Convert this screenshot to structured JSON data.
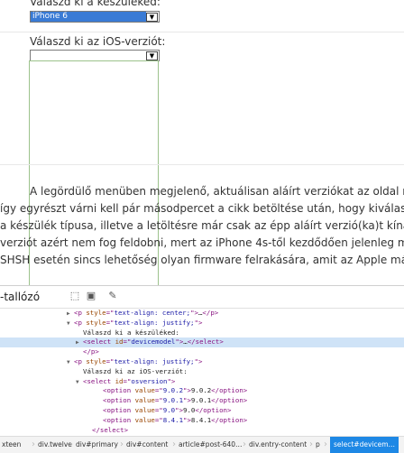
{
  "page": {
    "device_label": "Válaszd ki a készüléked:",
    "device_selected": "iPhone 6",
    "ios_label": "Válaszd ki az iOS-verziót:",
    "paragraph_lines": [
      "A legördülő menüben megjelenő, aktuálisan aláírt verziókat az oldal röptében ke",
      "így egyrészt várni kell pár másodpercet a cikk betöltése után, hogy kiválasztható",
      "a készülék típusa, illetve a letöltésre már csak az épp aláírt verzió(ka)t kínálja fel.",
      "verziót azért nem fog feldobni, mert az iPhone 4s-től kezdődően jelenleg még",
      "SHSH esetén sincs lehetőség olyan firmware felrakására, amit az Apple már nem"
    ]
  },
  "devtools": {
    "title": "-tallózó",
    "dom_rows": [
      {
        "indent": 74,
        "tri": "▶",
        "parts": [
          [
            "tag",
            "<p "
          ],
          [
            "attr",
            "style"
          ],
          [
            "tag",
            "=\""
          ],
          [
            "val",
            "text-align: center;"
          ],
          [
            "tag",
            "\">"
          ],
          [
            "txt",
            "…"
          ],
          [
            "tag",
            "</p>"
          ]
        ]
      },
      {
        "indent": 74,
        "tri": "▼",
        "parts": [
          [
            "tag",
            "<p "
          ],
          [
            "attr",
            "style"
          ],
          [
            "tag",
            "=\""
          ],
          [
            "val",
            "text-align: justify;"
          ],
          [
            "tag",
            "\">"
          ]
        ]
      },
      {
        "indent": 84,
        "tri": "",
        "parts": [
          [
            "txt",
            "Válaszd ki a készüléked:"
          ]
        ]
      },
      {
        "indent": 84,
        "tri": "▶",
        "sel": true,
        "parts": [
          [
            "tag",
            "<select "
          ],
          [
            "attr",
            "id"
          ],
          [
            "tag",
            "=\""
          ],
          [
            "val",
            "devicemodel"
          ],
          [
            "tag",
            "\">"
          ],
          [
            "txt",
            "…"
          ],
          [
            "tag",
            "</select>"
          ]
        ]
      },
      {
        "indent": 84,
        "tri": "",
        "parts": [
          [
            "tag",
            "</p>"
          ]
        ]
      },
      {
        "indent": 74,
        "tri": "▼",
        "parts": [
          [
            "tag",
            "<p "
          ],
          [
            "attr",
            "style"
          ],
          [
            "tag",
            "=\""
          ],
          [
            "val",
            "text-align: justify;"
          ],
          [
            "tag",
            "\">"
          ]
        ]
      },
      {
        "indent": 84,
        "tri": "",
        "parts": [
          [
            "txt",
            "Válaszd ki az iOS-verziót:"
          ]
        ]
      },
      {
        "indent": 84,
        "tri": "▼",
        "parts": [
          [
            "tag",
            "<select "
          ],
          [
            "attr",
            "id"
          ],
          [
            "tag",
            "=\""
          ],
          [
            "val",
            "osversion"
          ],
          [
            "tag",
            "\">"
          ]
        ]
      },
      {
        "indent": 106,
        "tri": "",
        "parts": [
          [
            "tag",
            "<option "
          ],
          [
            "attr",
            "value"
          ],
          [
            "tag",
            "=\""
          ],
          [
            "val",
            "9.0.2"
          ],
          [
            "tag",
            "\">"
          ],
          [
            "txt",
            "9.0.2"
          ],
          [
            "tag",
            "</option>"
          ]
        ]
      },
      {
        "indent": 106,
        "tri": "",
        "parts": [
          [
            "tag",
            "<option "
          ],
          [
            "attr",
            "value"
          ],
          [
            "tag",
            "=\""
          ],
          [
            "val",
            "9.0.1"
          ],
          [
            "tag",
            "\">"
          ],
          [
            "txt",
            "9.0.1"
          ],
          [
            "tag",
            "</option>"
          ]
        ]
      },
      {
        "indent": 106,
        "tri": "",
        "parts": [
          [
            "tag",
            "<option "
          ],
          [
            "attr",
            "value"
          ],
          [
            "tag",
            "=\""
          ],
          [
            "val",
            "9.0"
          ],
          [
            "tag",
            "\">"
          ],
          [
            "txt",
            "9.0"
          ],
          [
            "tag",
            "</option>"
          ]
        ]
      },
      {
        "indent": 106,
        "tri": "",
        "parts": [
          [
            "tag",
            "<option "
          ],
          [
            "attr",
            "value"
          ],
          [
            "tag",
            "=\""
          ],
          [
            "val",
            "8.4.1"
          ],
          [
            "tag",
            "\">"
          ],
          [
            "txt",
            "8.4.1"
          ],
          [
            "tag",
            "</option>"
          ]
        ]
      },
      {
        "indent": 94,
        "tri": "",
        "parts": [
          [
            "tag",
            "</select>"
          ]
        ]
      }
    ],
    "breadcrumbs": [
      "xteen",
      "div.twelve",
      "div#primary",
      "div#content",
      "article#post-640…",
      "div.entry-content",
      "p",
      "select#devicem…"
    ]
  }
}
